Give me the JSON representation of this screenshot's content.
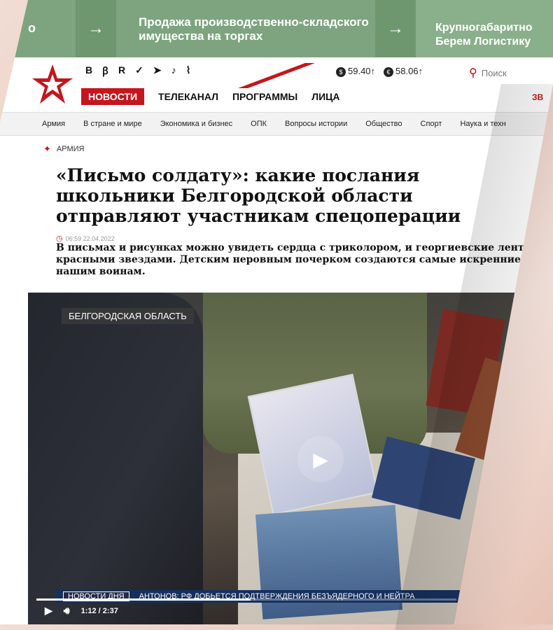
{
  "banner": {
    "left_fragment": "о",
    "arrow": "→",
    "ad1": "Продажа производственно-складского имущества на торгах",
    "ad2": "Крупногабаритно Берем Логистику"
  },
  "header": {
    "social_icons": [
      "vk-icon",
      "ok-icon",
      "rutube-icon",
      "twitter-icon",
      "telegram-icon",
      "tiktok-icon",
      "rss-icon"
    ],
    "social_glyphs": [
      "В",
      "ꞵ",
      "R",
      "✓",
      "➤",
      "♪",
      "⌇"
    ],
    "currency": [
      {
        "symbol": "$",
        "value": "59.40↑"
      },
      {
        "symbol": "€",
        "value": "58.06↑"
      }
    ],
    "search_placeholder": "Поиск",
    "nav": [
      "НОВОСТИ",
      "ТЕЛЕКАНАЛ",
      "ПРОГРАММЫ",
      "ЛИЦА"
    ],
    "nav_right_fragment": "ЗВ",
    "brand_color": "#c4161c"
  },
  "subnav": [
    "Армия",
    "В стране и мире",
    "Экономика и бизнес",
    "ОПК",
    "Вопросы истории",
    "Общество",
    "Спорт",
    "Наука и техн"
  ],
  "article": {
    "category": "АРМИЯ",
    "title": "«Письмо солдату»: какие послания школьники Белгородской области отправляют участникам спецоперации",
    "timestamp": "06:59 22.04.2022",
    "lead": "В письмах и рисунках можно увидеть сердца с триколором, и георгиевские лент красными звездами. Детским неровным почерком создаются самые искренние нашим воинам."
  },
  "video": {
    "region_label": "БЕЛГОРОДСКАЯ ОБЛАСТЬ",
    "ticker_tag": "НОВОСТИ ДНЯ",
    "ticker_text": "АНТОНОВ: РФ ДОБЬЕТСЯ ПОДТВЕРЖДЕНИЯ БЕЗЪЯДЕРНОГО И НЕЙТРА",
    "time": "1:12 / 2:37",
    "progress_fraction": 0.51
  }
}
